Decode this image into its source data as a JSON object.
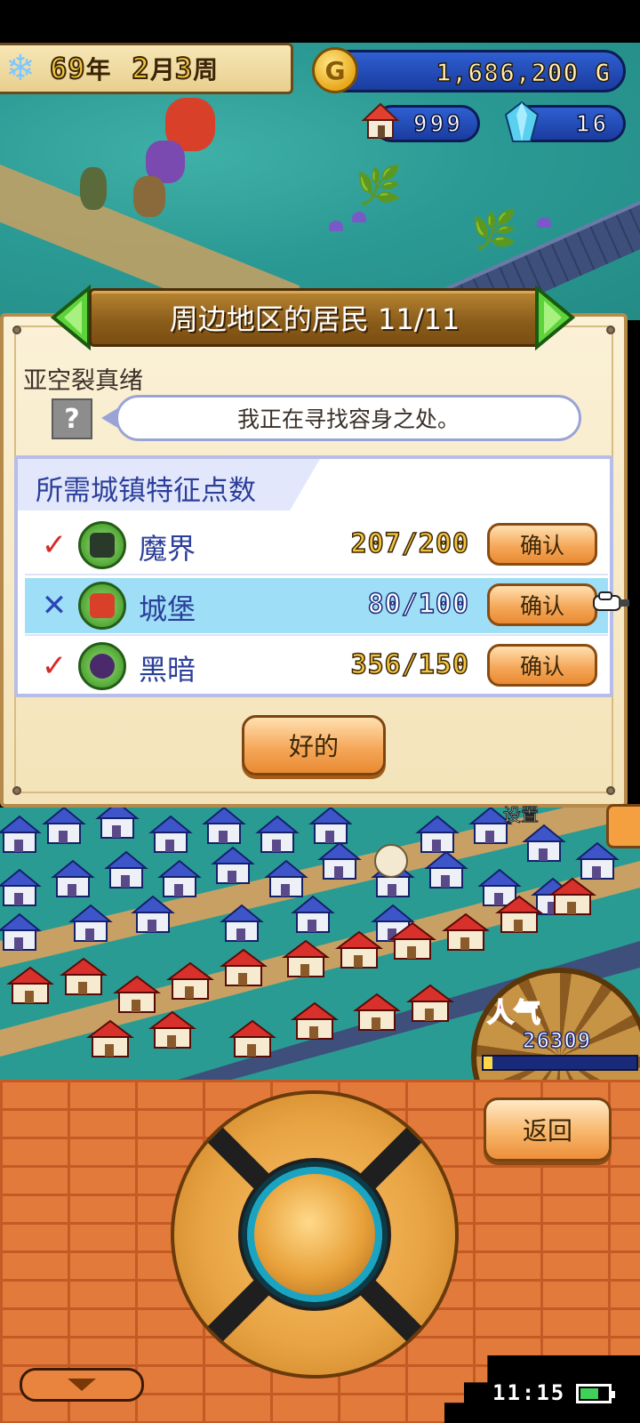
{
  "hud": {
    "year": "69",
    "year_unit": "年",
    "month": "2",
    "month_unit": "月",
    "week": "3",
    "week_unit": "周",
    "gold": "1,686,200",
    "gold_unit": "G",
    "coin_symbol": "G",
    "houses": "999",
    "crystals": "16"
  },
  "dialog": {
    "title": "周边地区的居民 11/11",
    "resident_name": "亚空裂真绪",
    "portrait_placeholder": "?",
    "speech": "我正在寻找容身之处。",
    "requirements_title": "所需城镇特征点数",
    "requirements": [
      {
        "status": "met",
        "mark": "✓",
        "label": "魔界",
        "value": "207/200",
        "button": "确认",
        "icon": "demon-world-icon"
      },
      {
        "status": "unmet",
        "mark": "✕",
        "label": "城堡",
        "value": "80/100",
        "button": "确认",
        "icon": "castle-icon"
      },
      {
        "status": "met",
        "mark": "✓",
        "label": "黑暗",
        "value": "356/150",
        "button": "确认",
        "icon": "darkness-icon"
      }
    ],
    "ok_button": "好的"
  },
  "town": {
    "settings_label": "设置",
    "popularity_label": "人气",
    "popularity_value": "26309",
    "popularity_fill": 0.06
  },
  "controller": {
    "back_button": "返回"
  },
  "status_bar": {
    "time": "11:15",
    "battery_level": 0.6
  },
  "colors": {
    "panel_blue": "#2b3f9a",
    "selected_row": "#9edff7",
    "check_red": "#d72b2b",
    "cross_blue": "#2c44b8",
    "gold_text": "#f3c640",
    "brick": "#e27a3c"
  }
}
